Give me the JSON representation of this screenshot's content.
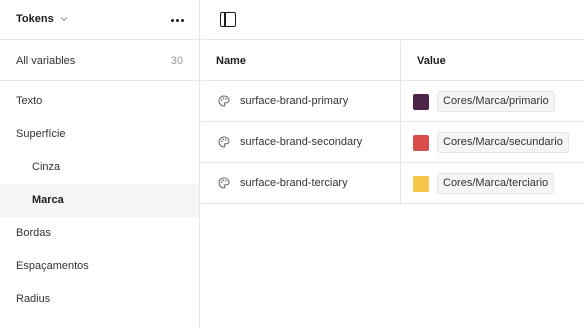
{
  "sidebar": {
    "collection_name": "Tokens",
    "all_variables": {
      "label": "All variables",
      "count": "30"
    },
    "groups": [
      {
        "label": "Texto"
      },
      {
        "label": "Superfície"
      },
      {
        "label": "Cinza"
      },
      {
        "label": "Marca"
      },
      {
        "label": "Bordas"
      },
      {
        "label": "Espaçamentos"
      },
      {
        "label": "Radius"
      }
    ],
    "active_group": "Marca"
  },
  "table": {
    "headers": {
      "name": "Name",
      "value": "Value"
    },
    "rows": [
      {
        "name": "surface-brand-primary",
        "color": "#4a2545",
        "alias": "Cores/Marca/primario"
      },
      {
        "name": "surface-brand-secondary",
        "color": "#d94c4c",
        "alias": "Cores/Marca/secundario"
      },
      {
        "name": "surface-brand-terciary",
        "color": "#f5c54a",
        "alias": "Cores/Marca/terciario"
      }
    ]
  },
  "icons": {
    "collection_dropdown": "chevron-down-icon",
    "more": "more-horizontal-icon",
    "panel_toggle": "sidebar-toggle-icon",
    "variable_type": "color-palette-icon"
  }
}
